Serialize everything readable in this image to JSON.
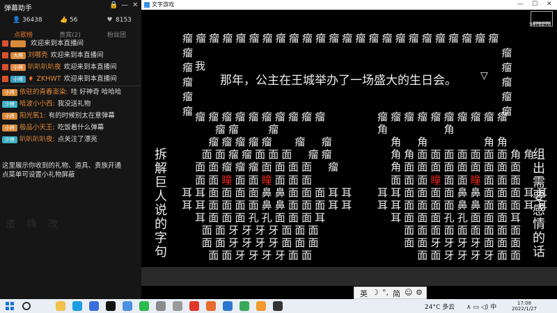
{
  "left_panel": {
    "title": "弹幕助手",
    "window_controls": {
      "lock": "🔒",
      "min": "—",
      "close": "✕"
    },
    "stats": [
      {
        "icon": "person-icon",
        "glyph": "👤",
        "value": "36438"
      },
      {
        "icon": "thumb-up-icon",
        "glyph": "👍",
        "value": "56"
      },
      {
        "icon": "heart-icon",
        "glyph": "♥",
        "value": "8153"
      }
    ],
    "tabs": [
      {
        "label": "点歌榜",
        "active": true
      },
      {
        "label": "贵宾(2)",
        "active": false
      },
      {
        "label": "粉丝团",
        "active": false
      }
    ],
    "feed": [
      {
        "mark": "#d9512c",
        "level": "",
        "level_color": "#d88a3a",
        "user": "",
        "text": "欢迎来到本直播间"
      },
      {
        "mark": "#d9512c",
        "level": "大将",
        "level_color": "#d88a3a",
        "user": "刘哪壳",
        "text": "欢迎来到本直播间"
      },
      {
        "mark": "#d9512c",
        "level": "小将",
        "level_color": "#e08a40",
        "user": "叭叭叭叭夜",
        "text": "欢迎来到本直播间"
      },
      {
        "mark": "#d9512c",
        "level": "小将",
        "level_color": "#3aa0c0",
        "badge": "♦",
        "user": "ZKHWT",
        "text": "欢迎来到本直播间"
      },
      {
        "mark": "",
        "level": "小将",
        "level_color": "#d88a3a",
        "user": "依驻的青春澎染:",
        "text": "哇 好神奇 哈哈哈"
      },
      {
        "mark": "",
        "level": "少侠",
        "level_color": "#3ab0c0",
        "user": "哈波小小西:",
        "text": "我没送礼物"
      },
      {
        "mark": "",
        "level": "小将",
        "level_color": "#d88a3a",
        "user": "阳光氧1:",
        "text": "有的时候别太在意弹幕"
      },
      {
        "mark": "",
        "level": "小将",
        "level_color": "#d88a3a",
        "user": "极品小天王:",
        "text": "吃饭着什么弹幕"
      },
      {
        "mark": "",
        "level": "少侠",
        "level_color": "#3ab0c0",
        "user": "叭叭叭叭夜:",
        "text": "点关注了漂亮"
      }
    ],
    "notice": [
      "这里展示你收到的礼物、道具、贵族开通",
      "点菜单可设置小礼物屏蔽"
    ],
    "ghost_text": "渣 嗨 改"
  },
  "game_window": {
    "title": "文字游戏",
    "controls": {
      "min": "—",
      "max": "☐",
      "close": "✕"
    },
    "logo_number": "9478270",
    "dialogue": "那年，公主在王城举办了一场盛大的生日会。",
    "cursor": "▽",
    "speaker": "我",
    "box_char": "瘤",
    "left_column": [
      "拆",
      "解",
      "巨",
      "人",
      "说",
      "的",
      "字",
      "句"
    ],
    "right_column": [
      "组",
      "出",
      "需",
      "要",
      "感",
      "情",
      "的",
      "话"
    ],
    "face_rows": [
      "    瘤瘤瘤瘤瘤瘤瘤瘤瘤瘤",
      "       瘤瘤    瘤",
      "      瘤瘤瘤瘤瘤   瘤  瘤",
      "     面面瘤瘤面面面  瘤瘤",
      "    面面瘤瘤瘤面面面面  瘤",
      "    面面瞳面面瞳面面面",
      "  耳耳面面面面鼻鼻面面面耳耳",
      "  耳耳面面面面鼻鼻面面面耳耳",
      "    耳面面面孔孔面面面耳",
      "     面面牙牙牙牙面面面",
      "     面面牙牙牙牙面面面",
      "      面面牙牙牙牙面面"
    ],
    "face_rows_right": [
      "瘤瘤瘤瘤瘤瘤瘤瘤瘤瘤",
      "角        角",
      "  角  角        角角",
      "  角角面面面面面面面角角",
      "  角面面面面面面面面面",
      "  面面面瞳面面瞳面面面",
      "耳耳面面面面鼻鼻面面面耳耳",
      "耳耳面面面面鼻鼻面面面耳耳",
      "  耳面面面孔孔面面面耳",
      "    面面面面面面面面面",
      "    面面牙牙牙牙面面面",
      "      面面牙牙牙牙面面"
    ],
    "red_char": "瞳"
  },
  "ime": {
    "lang": "英",
    "moon": "☽",
    "dot": "°,",
    "mode": "简",
    "emoji": "☺",
    "gear": "⚙"
  },
  "taskbar": {
    "weather": "24°C 多云",
    "tray_icons": "∧ ▭ ◁) 中",
    "time": "17:08",
    "date": "2022/1/27",
    "apps": [
      {
        "name": "search",
        "color": "#e8eef4"
      },
      {
        "name": "widgets",
        "color": "#e8eef4"
      },
      {
        "name": "folder",
        "color": "#f2c14e"
      },
      {
        "name": "edge",
        "color": "#1b9de2"
      },
      {
        "name": "store",
        "color": "#3a6fd9"
      },
      {
        "name": "qq",
        "color": "#111111"
      },
      {
        "name": "mail",
        "color": "#4a8fe0"
      },
      {
        "name": "wechat",
        "color": "#2db84d"
      },
      {
        "name": "app-gray",
        "color": "#8a8a8a"
      },
      {
        "name": "app-gray2",
        "color": "#9a9a9a"
      },
      {
        "name": "weibo",
        "color": "#e0362c"
      },
      {
        "name": "app-orange",
        "color": "#e86a2c"
      },
      {
        "name": "app-blue",
        "color": "#2b77d0"
      },
      {
        "name": "app-green",
        "color": "#3aa85a"
      },
      {
        "name": "app-orange2",
        "color": "#f29a2e"
      },
      {
        "name": "game",
        "color": "#333333"
      }
    ]
  }
}
